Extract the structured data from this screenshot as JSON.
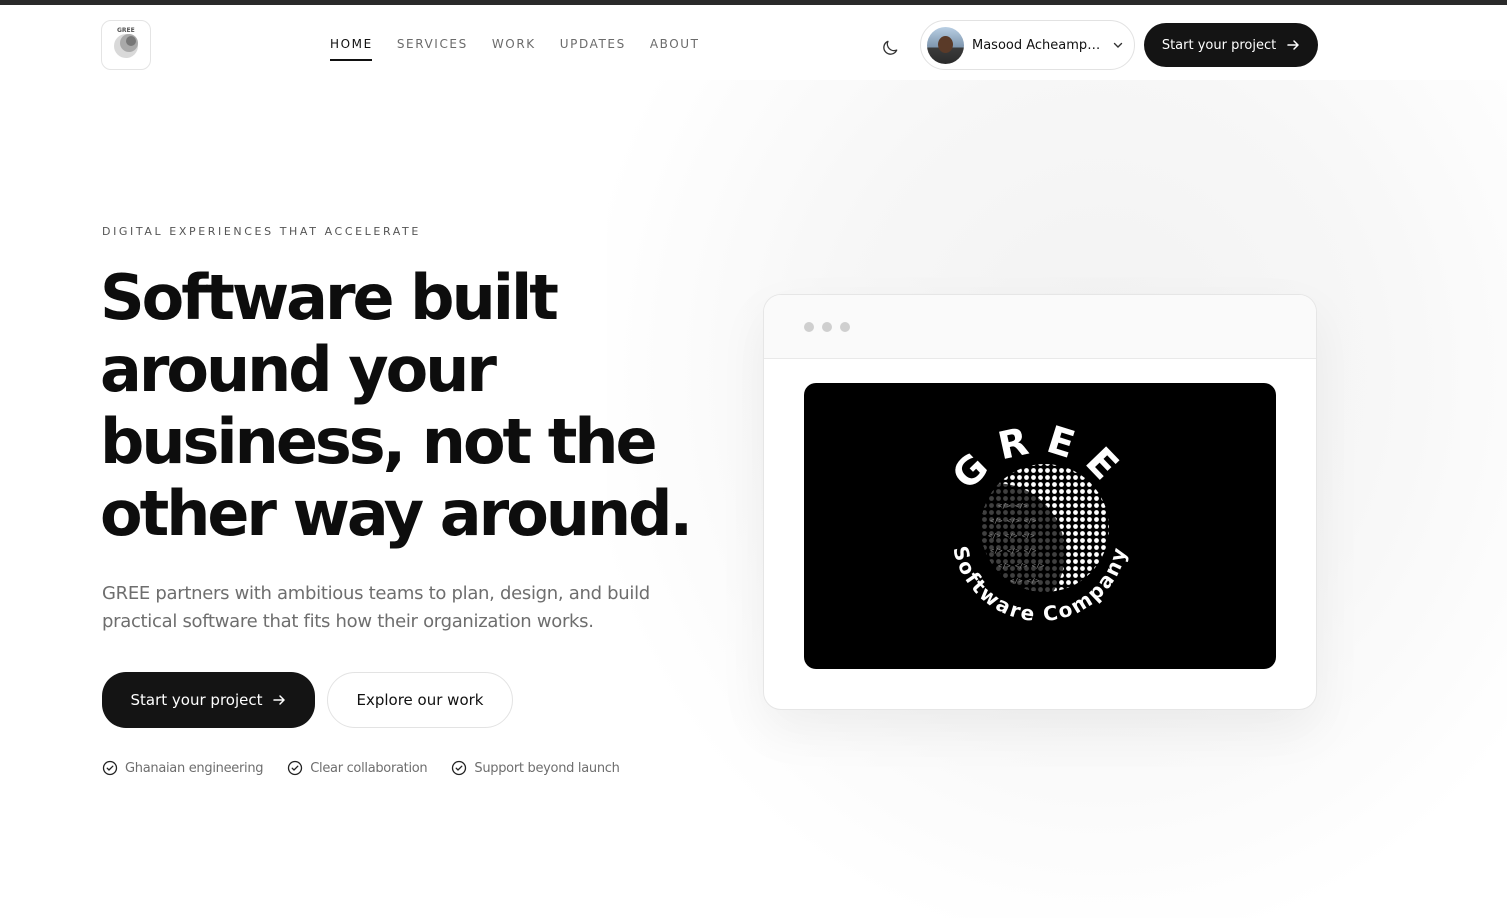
{
  "brand": {
    "logo_icon": "gree-globe-logo"
  },
  "nav": {
    "items": [
      {
        "label": "HOME",
        "active": true
      },
      {
        "label": "SERVICES",
        "active": false
      },
      {
        "label": "WORK",
        "active": false
      },
      {
        "label": "UPDATES",
        "active": false
      },
      {
        "label": "ABOUT",
        "active": false
      }
    ]
  },
  "header": {
    "theme_toggle_icon": "moon-icon",
    "user_name": "Masood Acheampong",
    "cta_label": "Start your project"
  },
  "hero": {
    "eyebrow": "DIGITAL EXPERIENCES THAT ACCELERATE",
    "headline_lines": [
      "Software built",
      "around your",
      "business, not the",
      "other way around."
    ],
    "subcopy": "GREE partners with ambitious teams to plan, design, and build practical software that fits how their organization works.",
    "primary_cta": "Start your project",
    "secondary_cta": "Explore our work",
    "features": [
      "Ghanaian engineering",
      "Clear collaboration",
      "Support beyond launch"
    ]
  },
  "showcase": {
    "logo_top_text": "GREE",
    "logo_bottom_text": "Software Company"
  },
  "colors": {
    "accent": "#141414",
    "muted_text": "#6e6e6e",
    "border": "#e4e4e4"
  }
}
